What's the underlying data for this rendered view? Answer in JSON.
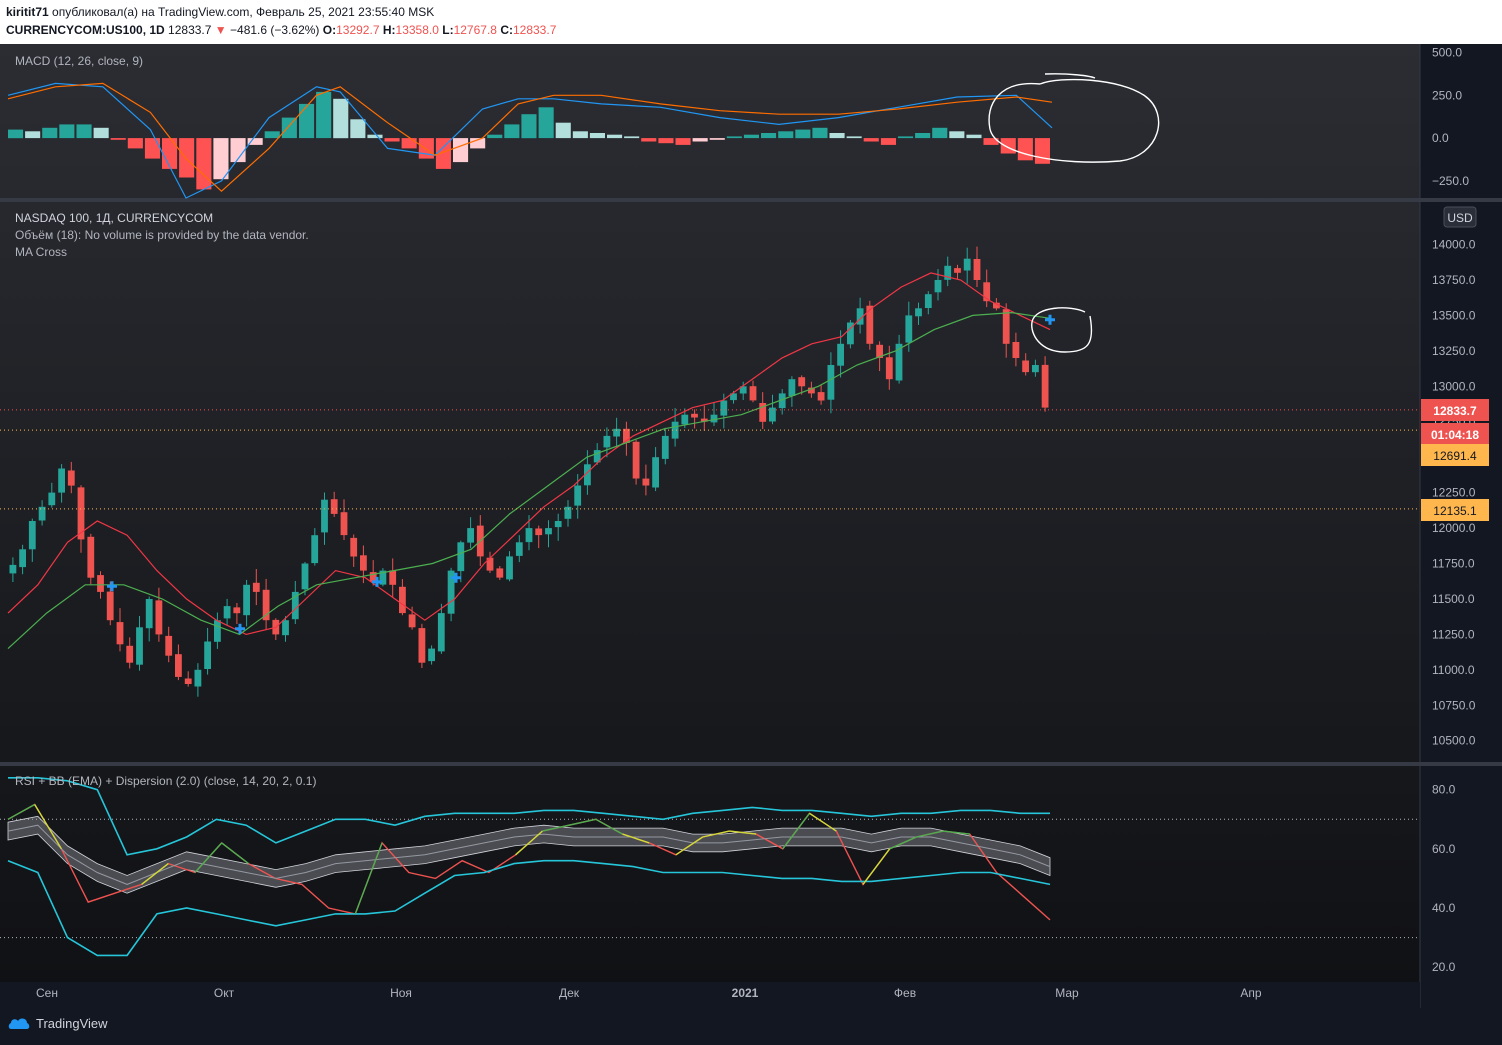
{
  "header": {
    "author": "kiritit71",
    "published": "опубликовал(а) на TradingView.com, Февраль 25, 2021 23:55:40 MSK",
    "symbol": "CURRENCYCOM:US100, 1D",
    "last": "12833.7",
    "arrow": "▼",
    "change": "−481.6 (−3.62%)",
    "o_label": "O:",
    "o": "13292.7",
    "h_label": "H:",
    "h": "13358.0",
    "l_label": "L:",
    "l": "12767.8",
    "c_label": "C:",
    "c": "12833.7"
  },
  "panes": {
    "macd_title": "MACD (12, 26, close, 9)",
    "price_title": "NASDAQ 100, 1Д, CURRENCYCOM",
    "volume_note": "Объём (18): No volume is provided by the data vendor.",
    "ma_title": "MA Cross",
    "rsi_title": "RSI + BB (EMA) + Dispersion (2.0) (close, 14, 20, 2, 0.1)",
    "currency": "USD"
  },
  "price_labels": {
    "last": "12833.7",
    "countdown": "01:04:18",
    "level1": "12691.4",
    "level2": "12135.1"
  },
  "footer": {
    "brand": "TradingView"
  },
  "colors": {
    "up": "#26a69a",
    "down": "#ef5350",
    "macd": "#2196f3",
    "signal": "#ff6d00",
    "ma_fast": "#f23645",
    "ma_slow": "#4caf50",
    "bb": "#26c6da"
  },
  "chart_data": [
    {
      "type": "line",
      "title": "MACD (12, 26, close, 9)",
      "ylim": [
        -350,
        550
      ],
      "yticks": [
        "500.0",
        "250.0",
        "0.0",
        "−250.0"
      ],
      "x_days": [
        0,
        8,
        16,
        24,
        30,
        36,
        44,
        52,
        56,
        64,
        72,
        80,
        86,
        92,
        100,
        110,
        120,
        130,
        140,
        150,
        160,
        170,
        176
      ],
      "series": [
        {
          "name": "MACD",
          "values": [
            250,
            320,
            300,
            50,
            -350,
            -250,
            120,
            300,
            270,
            -60,
            -100,
            170,
            230,
            230,
            200,
            180,
            120,
            80,
            120,
            180,
            240,
            250,
            60
          ]
        },
        {
          "name": "Signal",
          "values": [
            230,
            300,
            320,
            150,
            -120,
            -310,
            -60,
            250,
            300,
            90,
            -100,
            0,
            200,
            250,
            250,
            200,
            160,
            140,
            140,
            170,
            210,
            240,
            210
          ]
        }
      ],
      "histogram": [
        50,
        40,
        60,
        80,
        80,
        60,
        -10,
        -60,
        -120,
        -180,
        -230,
        -300,
        -240,
        -140,
        -40,
        40,
        120,
        200,
        270,
        230,
        110,
        20,
        -20,
        -60,
        -120,
        -180,
        -140,
        -60,
        20,
        80,
        140,
        180,
        90,
        40,
        30,
        20,
        10,
        -20,
        -30,
        -40,
        -20,
        -10,
        10,
        20,
        30,
        40,
        50,
        60,
        30,
        10,
        -20,
        -40,
        10,
        30,
        60,
        40,
        20,
        -40,
        -90,
        -130,
        -150
      ]
    },
    {
      "type": "candlestick",
      "title": "NASDAQ 100, 1Д, CURRENCYCOM",
      "ylim": [
        10350,
        14300
      ],
      "yticks": [
        "14000.0",
        "13750.0",
        "13500.0",
        "13250.0",
        "13000.0",
        "12750.0",
        "12500.0",
        "12250.0",
        "12000.0",
        "11750.0",
        "11500.0",
        "11250.0",
        "11000.0",
        "10750.0",
        "10500.0"
      ],
      "xticks": [
        "Сен",
        "Окт",
        "Ноя",
        "Дек",
        "2021",
        "Фев",
        "Мар",
        "Апр"
      ],
      "close_path": [
        11740,
        11850,
        12050,
        12150,
        12250,
        12420,
        12300,
        11920,
        11650,
        11550,
        11350,
        11180,
        11050,
        11300,
        11500,
        11250,
        11100,
        10950,
        10900,
        11000,
        11200,
        11350,
        11450,
        11400,
        11600,
        11550,
        11350,
        11250,
        11350,
        11550,
        11750,
        11950,
        12200,
        12100,
        11950,
        11800,
        11700,
        11620,
        11700,
        11600,
        11400,
        11300,
        11050,
        11150,
        11400,
        11700,
        11900,
        12000,
        11800,
        11700,
        11650,
        11800,
        11900,
        12000,
        11950,
        12000,
        12050,
        12150,
        12300,
        12450,
        12550,
        12650,
        12700,
        12600,
        12350,
        12300,
        12500,
        12650,
        12750,
        12800,
        12780,
        12750,
        12800,
        12900,
        12950,
        13000,
        12900,
        12750,
        12850,
        12950,
        13050,
        13000,
        12950,
        12900,
        13150,
        13300,
        13450,
        13550,
        13300,
        13200,
        13050,
        13300,
        13500,
        13550,
        13650,
        13750,
        13850,
        13800,
        13900,
        13750,
        13600,
        13550,
        13300,
        13200,
        13100,
        13150,
        12850
      ],
      "ma_fast": [
        11400,
        11600,
        11900,
        12050,
        11950,
        11700,
        11500,
        11350,
        11250,
        11300,
        11500,
        11700,
        11650,
        11500,
        11350,
        11500,
        11750,
        11950,
        12150,
        12300,
        12500,
        12650,
        12750,
        12850,
        12900,
        13050,
        13200,
        13300,
        13350,
        13550,
        13700,
        13800,
        13750,
        13600,
        13500,
        13400
      ],
      "ma_slow": [
        11150,
        11400,
        11600,
        11600,
        11500,
        11350,
        11250,
        11450,
        11600,
        11650,
        11700,
        11750,
        11850,
        12100,
        12300,
        12500,
        12600,
        12700,
        12750,
        12800,
        12900,
        13000,
        13150,
        13250,
        13400,
        13500,
        13520,
        13480
      ],
      "cross_points": [
        [
          11590,
          11590
        ],
        [
          11290,
          11290
        ],
        [
          11620,
          11620
        ],
        [
          11650,
          11650
        ],
        [
          13470,
          13470
        ]
      ],
      "last_price": 12833.7,
      "levels": [
        12691.4,
        12135.1
      ]
    },
    {
      "type": "line",
      "title": "RSI + BB (EMA) + Dispersion (2.0) (close, 14, 20, 2, 0.1)",
      "ylim": [
        15,
        88
      ],
      "yticks": [
        "80.0",
        "60.0",
        "40.0",
        "20.0"
      ],
      "bands": [
        70,
        30
      ],
      "x_days": [
        0,
        5,
        10,
        15,
        20,
        25,
        30,
        35,
        40,
        45,
        50,
        55,
        60,
        65,
        70,
        75,
        80,
        85,
        90,
        95,
        100,
        105,
        110,
        115,
        120,
        125,
        130,
        135,
        140,
        145,
        150,
        155,
        160,
        165,
        170,
        175
      ],
      "series": [
        {
          "name": "RSI",
          "values": [
            70,
            75,
            60,
            42,
            45,
            48,
            55,
            52,
            62,
            55,
            50,
            48,
            40,
            38,
            62,
            52,
            50,
            56,
            52,
            58,
            66,
            68,
            70,
            65,
            62,
            58,
            64,
            66,
            65,
            60,
            72,
            66,
            48,
            60,
            64,
            66,
            65,
            52,
            44,
            36
          ]
        },
        {
          "name": "Upper band",
          "values": [
            84,
            84,
            83,
            80,
            58,
            60,
            64,
            70,
            68,
            62,
            66,
            70,
            70,
            68,
            71,
            72,
            72,
            72,
            73,
            73,
            72,
            71,
            70,
            72,
            73,
            74,
            73,
            73,
            72,
            71,
            72,
            72,
            73,
            73,
            72,
            72
          ]
        },
        {
          "name": "Basis",
          "values": [
            66,
            68,
            58,
            52,
            48,
            52,
            56,
            54,
            52,
            50,
            52,
            55,
            56,
            57,
            58,
            60,
            62,
            64,
            65,
            64,
            64,
            64,
            64,
            62,
            62,
            63,
            64,
            64,
            64,
            62,
            64,
            64,
            62,
            60,
            58,
            54
          ]
        },
        {
          "name": "Lower band",
          "values": [
            56,
            52,
            30,
            24,
            24,
            38,
            40,
            38,
            36,
            34,
            36,
            38,
            38,
            39,
            45,
            51,
            52,
            55,
            56,
            56,
            55,
            54,
            52,
            52,
            52,
            51,
            50,
            50,
            49,
            49,
            50,
            51,
            52,
            52,
            50,
            48
          ]
        }
      ]
    }
  ]
}
